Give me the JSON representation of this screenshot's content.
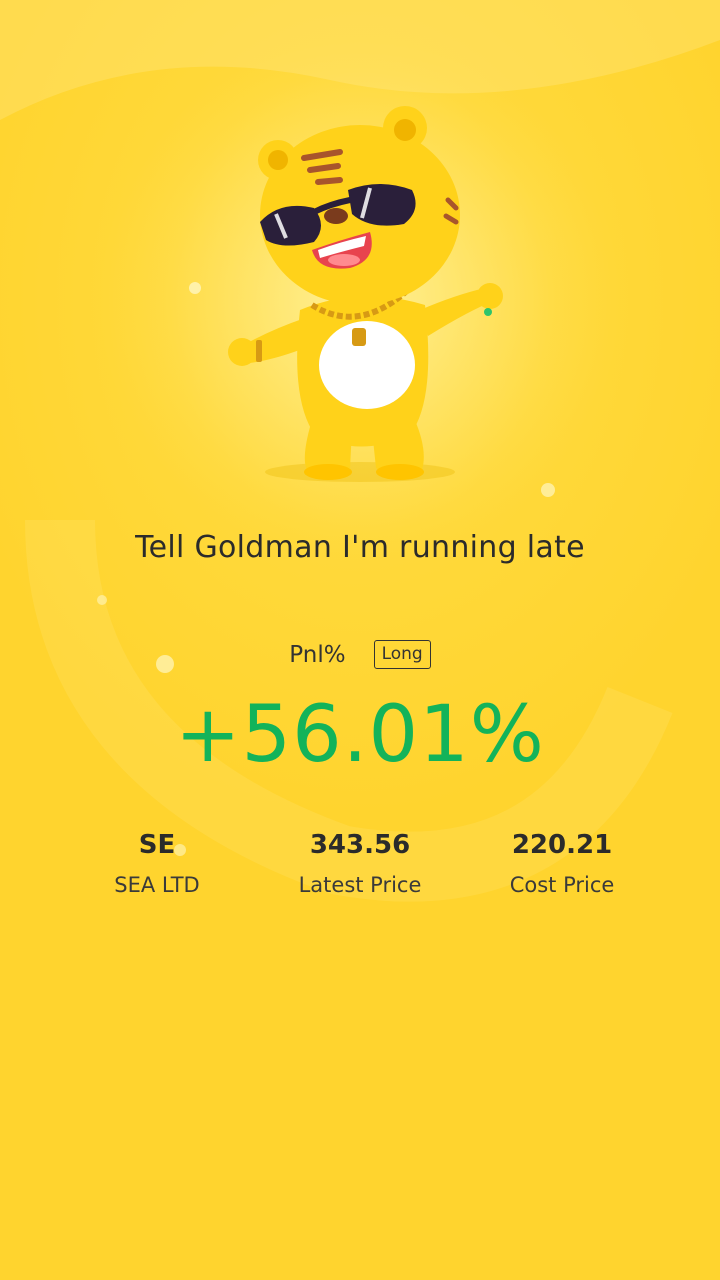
{
  "colors": {
    "background": "#ffd42e",
    "background_glow": "#ffe36a",
    "profit_green": "#13b35a",
    "text_dark": "#2b2b2b"
  },
  "mascot": {
    "icon": "tiger-mascot-sunglasses-icon"
  },
  "tagline": "Tell Goldman I'm running late",
  "pnl": {
    "label": "Pnl%",
    "position_type": "Long",
    "value": "+56.01%"
  },
  "stats": [
    {
      "value": "SE",
      "label": "SEA LTD"
    },
    {
      "value": "343.56",
      "label": "Latest Price"
    },
    {
      "value": "220.21",
      "label": "Cost Price"
    }
  ]
}
